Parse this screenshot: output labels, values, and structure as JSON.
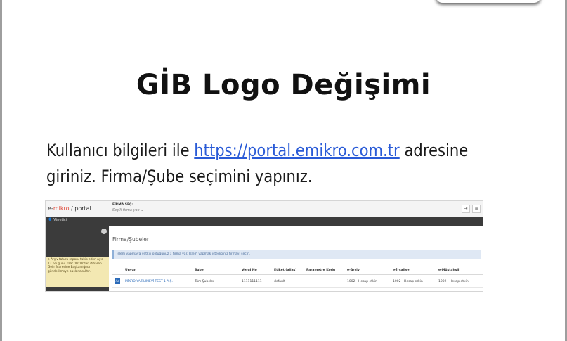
{
  "slide": {
    "title": "GİB Logo Değişimi",
    "text_before": "Kullanıcı bilgileri ile ",
    "link": "https://portal.emikro.com.tr",
    "text_after": " adresine giriniz. Firma/Şube seçimini yapınız."
  },
  "portal": {
    "brand_prefix": "e-",
    "brand_name": "mikro",
    "brand_suffix": " / portal",
    "firma_label": "FİRMA SEÇ:",
    "firma_value": "Seçili firma yok ⌄",
    "user": "Yönetici",
    "sidebar_note": "e-Arşiv fatura raporu takip eden ayın 12 nci günü saat 00:00'dan itibaren Gelir İdaresine Başkanlığına gönderilmeye başlanacaktır.",
    "page_title": "Firma/Şubeler",
    "info": "İşlem yapmaya yetkili olduğunuz 1 firma var. İşlem yapmak istediğiniz firmayı seçin.",
    "columns": [
      "Unvan",
      "Şube",
      "Vergi No",
      "Etiket (alias)",
      "Parametre Kodu",
      "e-Arşiv",
      "e-İrsaliye",
      "e-Müstahsil"
    ],
    "row": {
      "icon": "Ac",
      "unvan": "MİKRO YAZILIMEVİ TEST-1 A.Ş.",
      "sube": "Tüm Şubeler",
      "vergi_no": "1111111111",
      "etiket": "default",
      "parametre": "",
      "e_arsiv": "1002 - Hesap etkin",
      "e_irsaliye": "1002 - Hesap etkin",
      "e_mustahsil": "1002 - Hesap etkin"
    },
    "icons": {
      "logout": "logout-icon",
      "menu": "menu-icon",
      "user": "user-icon",
      "toggle": "circle-arrow-icon"
    }
  }
}
